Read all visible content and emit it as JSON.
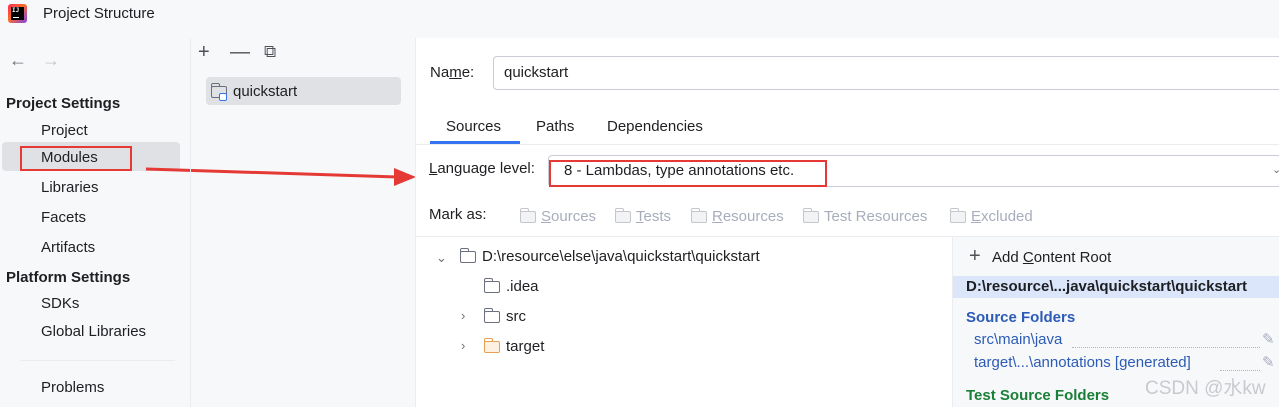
{
  "window": {
    "title": "Project Structure"
  },
  "nav": {
    "back": "←",
    "forward": "→"
  },
  "sidebar": {
    "project_settings": "Project Settings",
    "items": [
      "Project",
      "Modules",
      "Libraries",
      "Facets",
      "Artifacts"
    ],
    "platform_settings": "Platform Settings",
    "platform_items": [
      "SDKs",
      "Global Libraries"
    ],
    "problems": "Problems"
  },
  "modules_toolbar": {
    "add": "+",
    "remove": "—",
    "copy": "⧉"
  },
  "modules": [
    {
      "name": "quickstart"
    }
  ],
  "module": {
    "name_label_pre": "Na",
    "name_label_u": "m",
    "name_label_post": "e:",
    "name_value": "quickstart",
    "tabs": [
      "Sources",
      "Paths",
      "Dependencies"
    ],
    "language_label_u": "L",
    "language_label_post": "anguage level:",
    "language_level": "8 - Lambdas, type annotations etc.",
    "mark_as_label": "Mark as:",
    "mark_as": [
      {
        "u": "S",
        "rest": "ources"
      },
      {
        "u": "T",
        "rest": "ests"
      },
      {
        "u": "R",
        "rest": "esources"
      },
      {
        "u": "",
        "rest": "Test Resources"
      },
      {
        "u": "E",
        "rest": "xcluded"
      }
    ]
  },
  "tree": {
    "root": "D:\\resource\\else\\java\\quickstart\\quickstart",
    "children": [
      ".idea",
      "src",
      "target"
    ]
  },
  "content_root": {
    "add_pre": "Add ",
    "add_u": "C",
    "add_post": "ontent Root",
    "path": "D:\\resource\\...java\\quickstart\\quickstart",
    "source_folders_title": "Source Folders",
    "source_folders": [
      "src\\main\\java",
      "target\\...\\annotations [generated]"
    ],
    "test_source_title": "Test Source Folders"
  },
  "watermark": "CSDN @水kw",
  "colors": {
    "accent": "#3574f0",
    "highlight_box": "#e53935",
    "link": "#2c5bb5",
    "test_folder": "#1a7f37"
  }
}
